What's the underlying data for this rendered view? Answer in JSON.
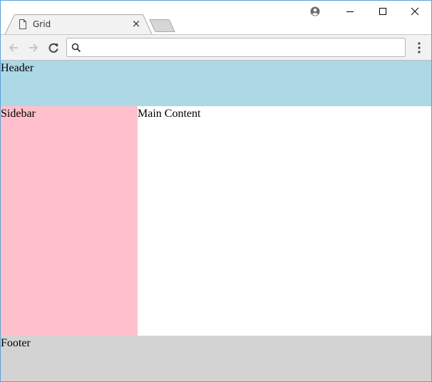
{
  "browser": {
    "tab": {
      "title": "Grid",
      "close_glyph": "×"
    },
    "omnibox": {
      "value": "",
      "placeholder": ""
    },
    "icons": {
      "tab_page": "page-icon",
      "new_tab": "new-tab-icon",
      "profile": "account-circle-icon",
      "minimize": "minimize-icon",
      "maximize": "maximize-icon",
      "close": "close-icon",
      "back": "back-arrow-icon",
      "forward": "forward-arrow-icon",
      "reload": "reload-icon",
      "search": "search-icon",
      "menu": "more-vertical-icon"
    }
  },
  "page": {
    "header": {
      "label": "Header",
      "color": "#add8e6"
    },
    "sidebar": {
      "label": "Sidebar",
      "color": "#ffc0cb"
    },
    "main": {
      "label": "Main Content",
      "color": "#ffffff"
    },
    "footer": {
      "label": "Footer",
      "color": "#d3d3d3"
    }
  }
}
